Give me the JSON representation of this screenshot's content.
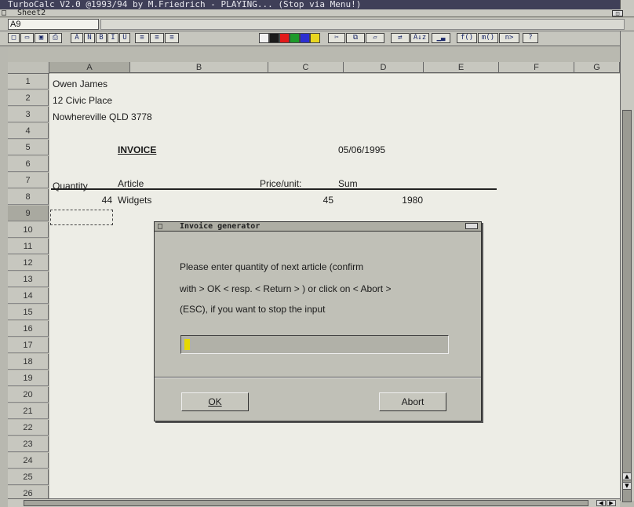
{
  "window": {
    "title": "TurboCalc V2.0 @1993/94 by M.Friedrich - PLAYING... (Stop via Menu!)",
    "sheet_title": "Sheet2",
    "close_glyph": "□",
    "depth_glyph": "◫"
  },
  "formula_bar": {
    "cell_ref": "A9",
    "value": ""
  },
  "toolbar": {
    "buttons": [
      {
        "name": "new-icon",
        "glyph": "□"
      },
      {
        "name": "open-icon",
        "glyph": "▭"
      },
      {
        "name": "save-icon",
        "glyph": "▣"
      },
      {
        "name": "print-icon",
        "glyph": "⎙"
      },
      {
        "name": "text-size-icon",
        "glyph": "A"
      },
      {
        "name": "normal-style-button",
        "glyph": "N"
      },
      {
        "name": "bold-button",
        "glyph": "B"
      },
      {
        "name": "italic-button",
        "glyph": "I"
      },
      {
        "name": "underline-button",
        "glyph": "U"
      },
      {
        "name": "align-left-button",
        "glyph": "≡"
      },
      {
        "name": "align-center-button",
        "glyph": "≡"
      },
      {
        "name": "align-right-button",
        "glyph": "≡"
      },
      {
        "name": "cut-icon",
        "glyph": "✂"
      },
      {
        "name": "copy-icon",
        "glyph": "⧉"
      },
      {
        "name": "paste-icon",
        "glyph": "▱"
      },
      {
        "name": "insert-button",
        "glyph": "⇄"
      },
      {
        "name": "sort-button",
        "glyph": "A↓z"
      },
      {
        "name": "chart-icon",
        "glyph": "▁▃"
      },
      {
        "name": "function-button",
        "glyph": "f()"
      },
      {
        "name": "macro-button",
        "glyph": "m()"
      },
      {
        "name": "next-button",
        "glyph": "n>"
      },
      {
        "name": "help-button",
        "glyph": "?"
      }
    ],
    "swatch_colors": [
      "#f2f2f2",
      "#1b1b1b",
      "#e21a1a",
      "#1e9a2a",
      "#2c2fd0",
      "#e8d620"
    ]
  },
  "grid": {
    "columns": [
      "A",
      "B",
      "C",
      "D",
      "E",
      "F",
      "G"
    ],
    "rows": [
      "1",
      "2",
      "3",
      "4",
      "5",
      "6",
      "7",
      "8",
      "9",
      "10",
      "11",
      "12",
      "13",
      "14",
      "15",
      "16",
      "17",
      "18",
      "19",
      "20",
      "21",
      "22",
      "23",
      "24",
      "25",
      "26"
    ],
    "cells": {
      "a1": "Owen James",
      "a2": "12 Civic Place",
      "a3": "Nowhereville QLD 3778",
      "b5": "INVOICE",
      "d5": "05/06/1995",
      "a7": "Quantity",
      "b7": "Article",
      "c7": "Price/unit:",
      "d7": "Sum",
      "a8": "44",
      "b8": "Widgets",
      "c8": "45",
      "d8": "1980"
    }
  },
  "dialog": {
    "title": "Invoice generator",
    "message_lines": [
      "Please enter quantity of next article (confirm",
      "with > OK < resp. < Return > ) or click on < Abort >",
      "(ESC), if you want to stop the input"
    ],
    "input_value": "",
    "ok_label": "OK",
    "abort_label": "Abort"
  }
}
